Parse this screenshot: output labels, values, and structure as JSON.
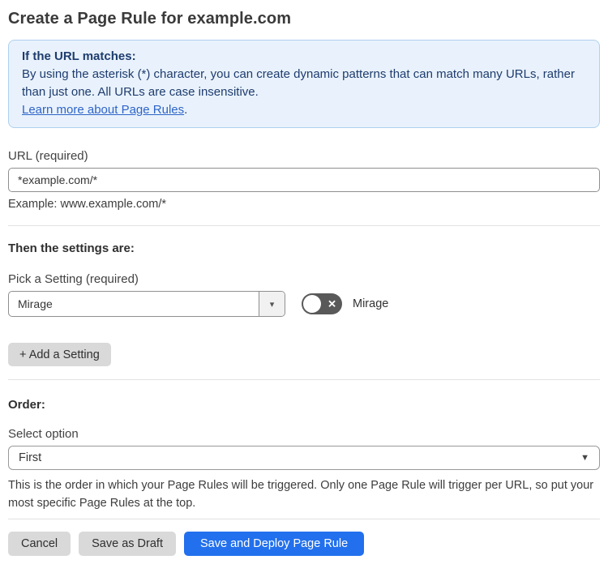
{
  "page": {
    "title": "Create a Page Rule for example.com"
  },
  "info_box": {
    "heading": "If the URL matches:",
    "body": "By using the asterisk (*) character, you can create dynamic patterns that can match many URLs, rather than just one. All URLs are case insensitive.",
    "link_text": "Learn more about Page Rules",
    "link_suffix": "."
  },
  "url_field": {
    "label": "URL (required)",
    "value": "*example.com/*",
    "helper": "Example: www.example.com/*"
  },
  "settings": {
    "heading": "Then the settings are:",
    "pick_label": "Pick a Setting (required)",
    "selected_setting": "Mirage",
    "caret_icon": "▾",
    "toggle_state": "off",
    "toggle_icon": "✕",
    "toggle_label": "Mirage",
    "add_button_label": "+ Add a Setting"
  },
  "order": {
    "heading": "Order:",
    "select_label": "Select option",
    "selected_option": "First",
    "caret_icon": "▼",
    "helper": "This is the order in which your Page Rules will be triggered. Only one Page Rule will trigger per URL, so put your most specific Page Rules at the top."
  },
  "footer": {
    "cancel_label": "Cancel",
    "save_draft_label": "Save as Draft",
    "deploy_label": "Save and Deploy Page Rule"
  },
  "colors": {
    "info_background": "#e9f2fc",
    "info_border": "#aecfee",
    "info_text": "#1e3c6e",
    "link_blue": "#2e64c8",
    "primary_button_blue": "#2270ed",
    "gray_button": "#d9d9d9",
    "toggle_off_gray": "#595959"
  }
}
